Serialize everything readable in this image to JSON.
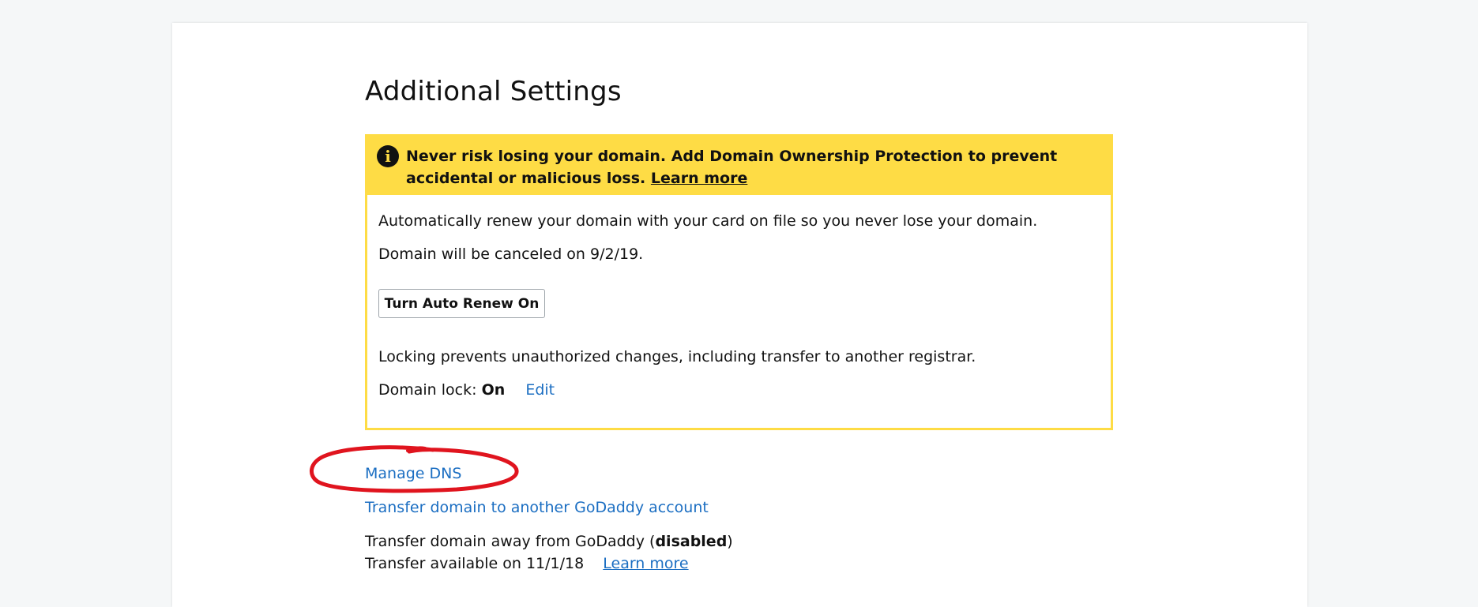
{
  "section": {
    "title": "Additional Settings"
  },
  "alert": {
    "icon": "info-icon",
    "message": "Never risk losing your domain. Add Domain Ownership Protection to prevent accidental or malicious loss.",
    "link_label": "Learn more"
  },
  "auto_renew": {
    "description": "Automatically renew your domain with your card on file so you never lose your domain.",
    "cancel_notice": "Domain will be canceled on 9/2/19.",
    "button_label": "Turn Auto Renew On"
  },
  "domain_lock": {
    "description": "Locking prevents unauthorized changes, including transfer to another registrar.",
    "label": "Domain lock:",
    "value": "On",
    "edit_label": "Edit"
  },
  "links": {
    "manage_dns": "Manage DNS",
    "transfer_internal": "Transfer domain to another GoDaddy account"
  },
  "transfer_away": {
    "label": "Transfer domain away from GoDaddy",
    "status": "disabled",
    "available_text": "Transfer available on 11/1/18",
    "learn_more": "Learn more"
  },
  "colors": {
    "accent_yellow": "#fedc45",
    "link_blue": "#1b6ec2",
    "annotation_red": "#e0141e"
  }
}
